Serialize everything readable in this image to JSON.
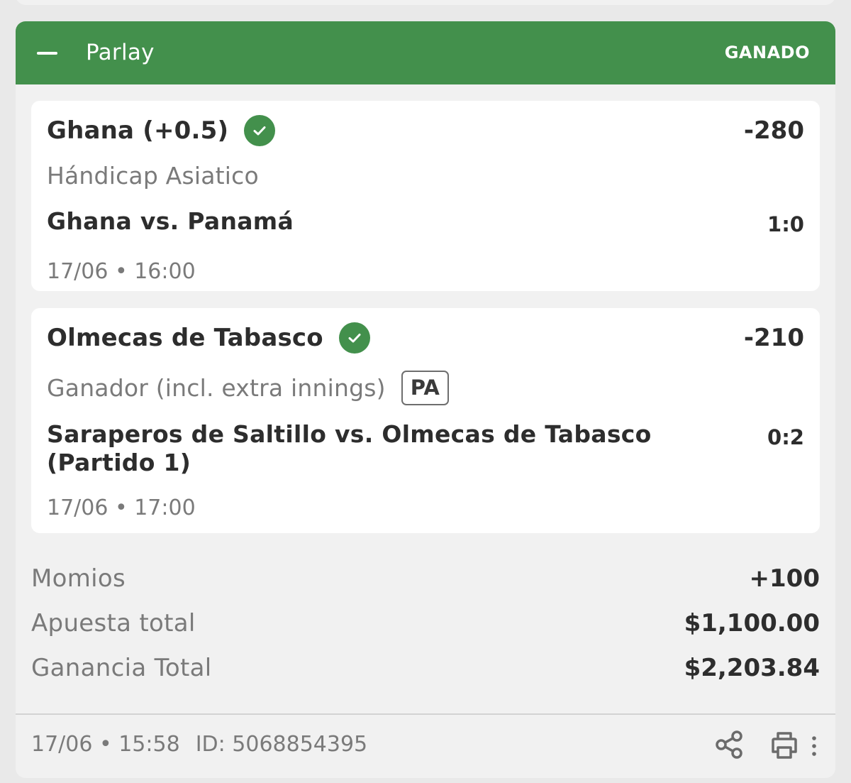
{
  "parlay": {
    "title": "Parlay",
    "status": "GANADO",
    "accent_color": "#43904c"
  },
  "selections": [
    {
      "name": "Ghana (+0.5)",
      "odds": "-280",
      "market": "Hándicap Asiatico",
      "badge": "",
      "event": "Ghana vs. Panamá",
      "score": "1:0",
      "date": "17/06 • 16:00",
      "icon": "check-circle-icon"
    },
    {
      "name": "Olmecas de Tabasco",
      "odds": "-210",
      "market": "Ganador (incl. extra innings)",
      "badge": "PA",
      "event": "Saraperos de Saltillo vs. Olmecas de Tabasco (Partido 1)",
      "score": "0:2",
      "date": "17/06 • 17:00",
      "icon": "check-circle-icon"
    }
  ],
  "summary": {
    "odds_label": "Momios",
    "odds_value": "+100",
    "stake_label": "Apuesta total",
    "stake_value": "$1,100.00",
    "win_label": "Ganancia Total",
    "win_value": "$2,203.84"
  },
  "footer": {
    "placed": "17/06 • 15:58",
    "id": "ID: 5068854395",
    "icons": [
      "share-icon",
      "print-icon",
      "more-vertical-icon"
    ]
  }
}
